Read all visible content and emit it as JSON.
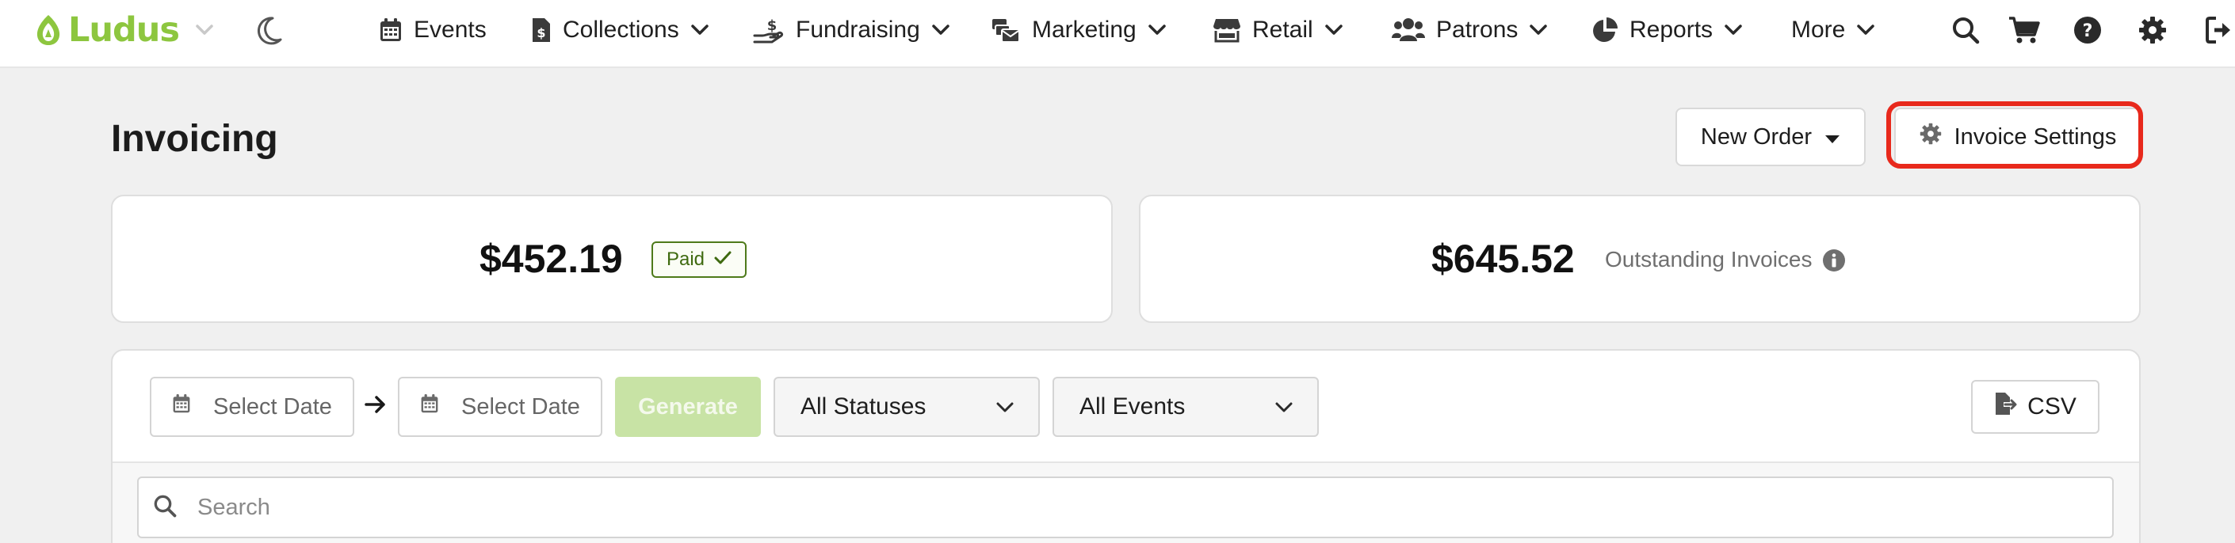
{
  "brand": {
    "name": "Ludus",
    "color": "#8dc63f"
  },
  "nav": {
    "items": [
      {
        "label": "Events",
        "icon": "calendar-icon"
      },
      {
        "label": "Collections",
        "icon": "invoice-dollar-icon"
      },
      {
        "label": "Fundraising",
        "icon": "hand-holding-dollar-icon"
      },
      {
        "label": "Marketing",
        "icon": "mail-bulk-icon"
      },
      {
        "label": "Retail",
        "icon": "store-icon"
      },
      {
        "label": "Patrons",
        "icon": "users-icon"
      },
      {
        "label": "Reports",
        "icon": "pie-chart-icon"
      },
      {
        "label": "More",
        "icon": ""
      }
    ],
    "right_icons": [
      "search-icon",
      "cart-icon",
      "help-icon",
      "gear-icon",
      "logout-icon"
    ]
  },
  "page": {
    "title": "Invoicing",
    "new_order_label": "New Order",
    "invoice_settings_label": "Invoice Settings"
  },
  "summary": {
    "paid_amount": "$452.19",
    "paid_badge": "Paid",
    "outstanding_amount": "$645.52",
    "outstanding_label": "Outstanding Invoices"
  },
  "filters": {
    "start_date_placeholder": "Select Date",
    "end_date_placeholder": "Select Date",
    "generate_label": "Generate",
    "status_value": "All Statuses",
    "events_value": "All Events",
    "csv_label": "CSV",
    "search_placeholder": "Search"
  },
  "colors": {
    "highlight": "#e8291c",
    "paid_badge": "#4e7a1a",
    "generate_disabled": "#c8e3a5"
  }
}
